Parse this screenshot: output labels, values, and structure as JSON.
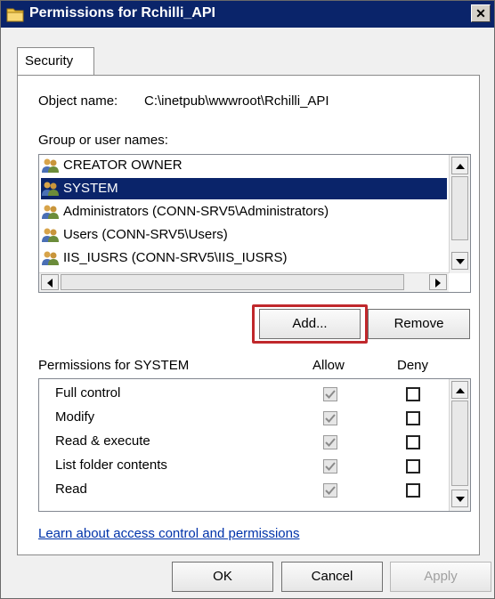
{
  "window": {
    "title": "Permissions for Rchilli_API",
    "close_glyph": "✕"
  },
  "tabs": [
    {
      "label": "Security"
    }
  ],
  "object": {
    "label": "Object name:",
    "value": "C:\\inetpub\\wwwroot\\Rchilli_API"
  },
  "groups": {
    "label": "Group or user names:",
    "items": [
      {
        "name": "CREATOR OWNER",
        "icon": "user-group-icon"
      },
      {
        "name": "SYSTEM",
        "icon": "user-group-icon"
      },
      {
        "name": "Administrators (CONN-SRV5\\Administrators)",
        "icon": "user-group-icon"
      },
      {
        "name": "Users (CONN-SRV5\\Users)",
        "icon": "user-group-icon"
      },
      {
        "name": "IIS_IUSRS (CONN-SRV5\\IIS_IUSRS)",
        "icon": "user-group-icon"
      }
    ],
    "selected_index": 1
  },
  "buttons": {
    "add": "Add...",
    "remove": "Remove",
    "ok": "OK",
    "cancel": "Cancel",
    "apply": "Apply"
  },
  "permissions": {
    "label": "Permissions for SYSTEM",
    "allow_header": "Allow",
    "deny_header": "Deny",
    "rows": [
      {
        "name": "Full control",
        "allow": true,
        "deny": false
      },
      {
        "name": "Modify",
        "allow": true,
        "deny": false
      },
      {
        "name": "Read & execute",
        "allow": true,
        "deny": false
      },
      {
        "name": "List folder contents",
        "allow": true,
        "deny": false
      },
      {
        "name": "Read",
        "allow": true,
        "deny": false
      }
    ]
  },
  "link": "Learn about access control and permissions",
  "colors": {
    "titlebar": "#0a246a",
    "selection": "#0a246a",
    "highlight_box": "#c0282c",
    "link": "#0033aa"
  }
}
